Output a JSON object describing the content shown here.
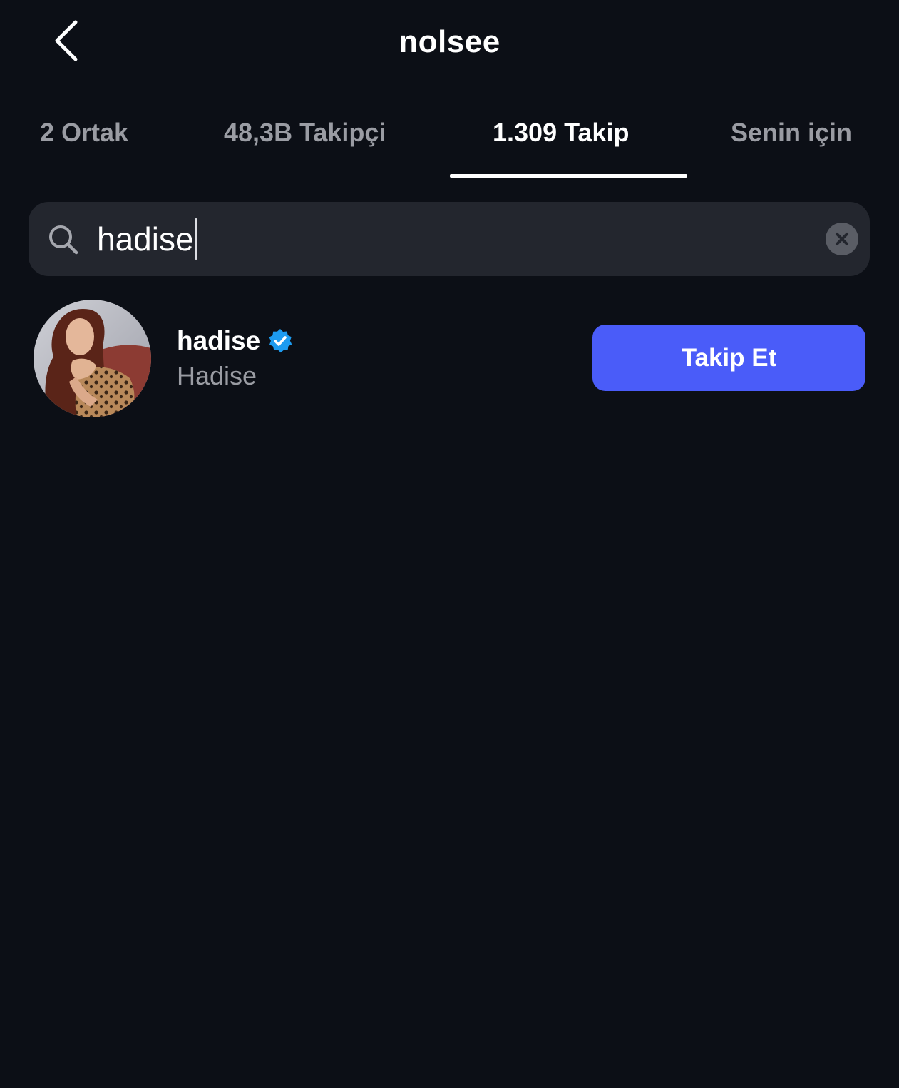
{
  "header": {
    "title": "nolsee",
    "back_icon": "chevron-left-icon"
  },
  "tabs": [
    {
      "label": "2 Ortak",
      "active": false
    },
    {
      "label": "48,3B Takipçi",
      "active": false
    },
    {
      "label": "1.309 Takip",
      "active": true
    },
    {
      "label": "Senin için",
      "active": false
    }
  ],
  "search": {
    "value": "hadise",
    "icon": "search-icon",
    "clear_icon": "clear-icon"
  },
  "results": [
    {
      "username": "hadise",
      "display_name": "Hadise",
      "verified": true,
      "button_label": "Takip Et"
    }
  ],
  "colors": {
    "background": "#0c0f16",
    "search_bg": "#23262e",
    "primary_button": "#4a5cf9",
    "verified_badge": "#1d9bf0",
    "muted_text": "#9a9ca3"
  }
}
